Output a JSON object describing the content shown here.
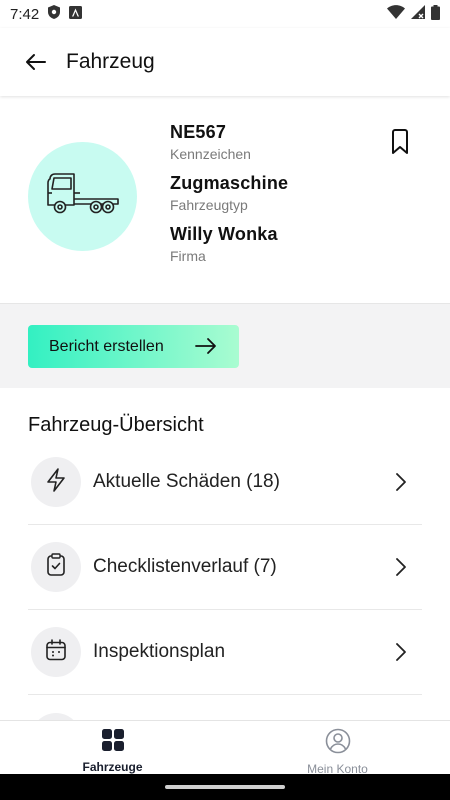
{
  "status_bar": {
    "time": "7:42"
  },
  "app_bar": {
    "title": "Fahrzeug"
  },
  "vehicle": {
    "plate": "NE567",
    "plate_label": "Kennzeichen",
    "type": "Zugmaschine",
    "type_label": "Fahrzeugtyp",
    "company": "Willy Wonka",
    "company_label": "Firma"
  },
  "actions": {
    "report_label": "Bericht erstellen"
  },
  "overview": {
    "heading": "Fahrzeug-Übersicht",
    "items": [
      {
        "label": "Aktuelle Schäden (18)",
        "icon": "lightning-icon"
      },
      {
        "label": "Checklistenverlauf (7)",
        "icon": "clipboard-check-icon"
      },
      {
        "label": "Inspektionsplan",
        "icon": "calendar-icon"
      }
    ]
  },
  "bottom_nav": {
    "items": [
      {
        "label": "Fahrzeuge",
        "icon": "grid-icon",
        "active": true
      },
      {
        "label": "Mein Konto",
        "icon": "account-icon",
        "active": false
      }
    ]
  },
  "colors": {
    "accent_start": "#33f0c2",
    "accent_end": "#a9fcd1",
    "avatar_bg": "#c8fbf1",
    "nav_active": "#1a1f2e"
  }
}
